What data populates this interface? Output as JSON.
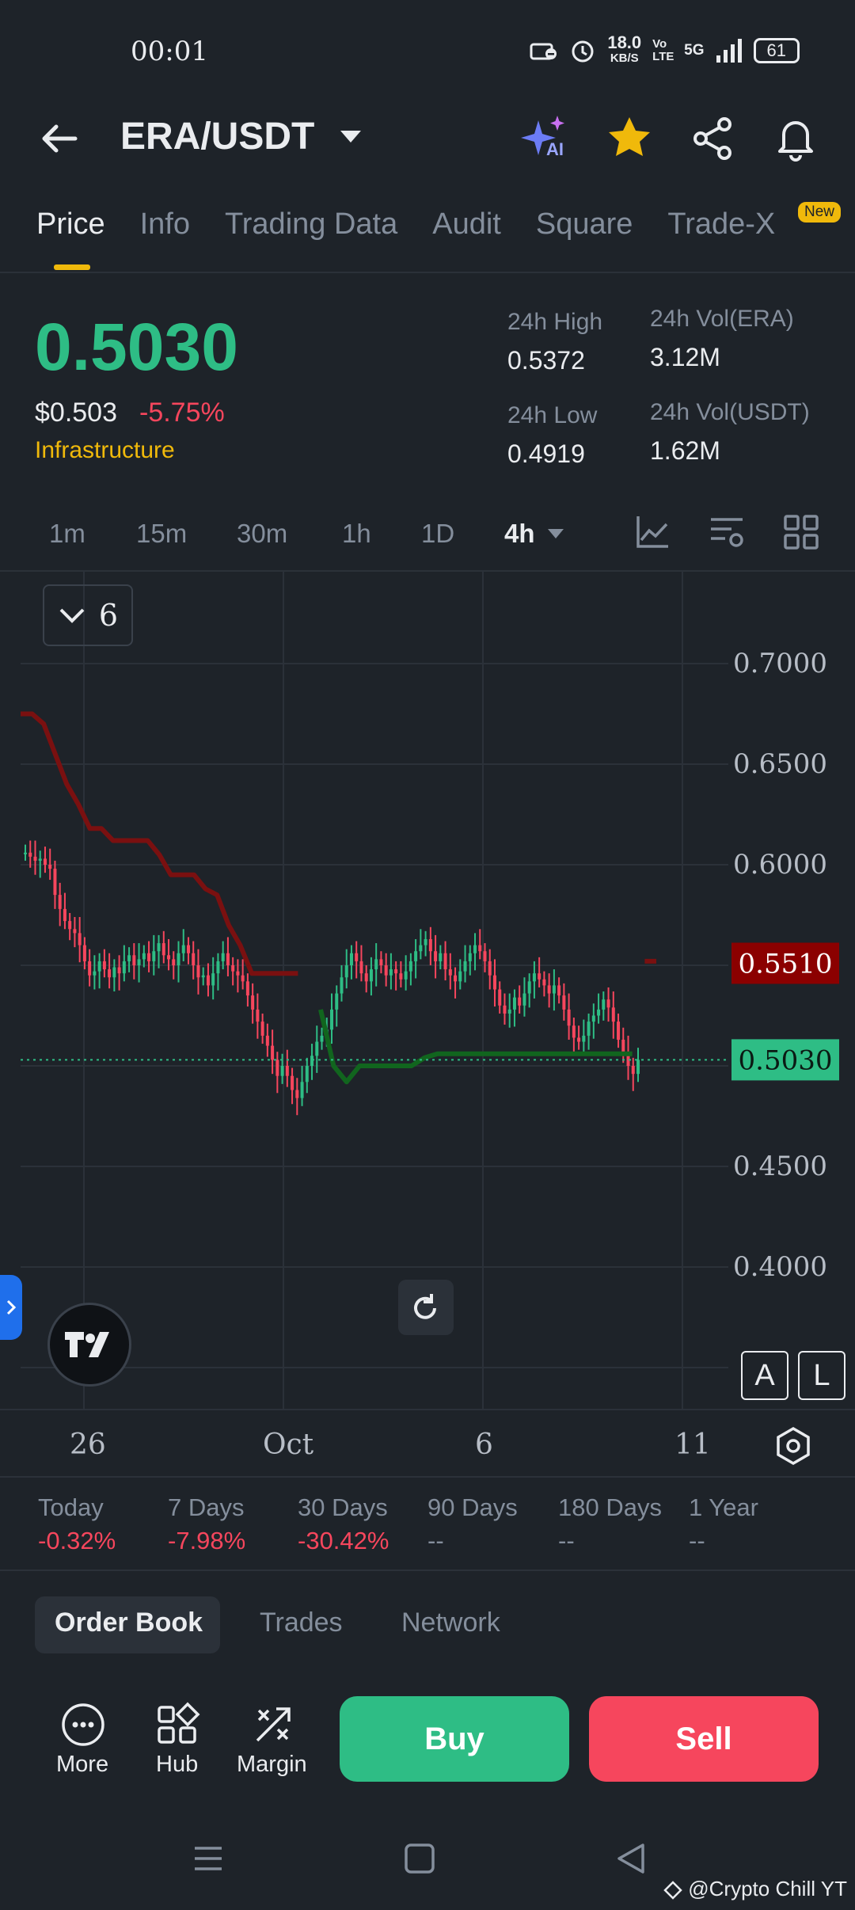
{
  "status": {
    "time": "00:01",
    "net_speed": "18.0",
    "net_unit": "KB/S",
    "volte": "Vo LTE",
    "net_type": "5G",
    "battery": "61"
  },
  "header": {
    "pair": "ERA/USDT",
    "ai_label": "AI"
  },
  "tabs": [
    {
      "label": "Price",
      "active": true
    },
    {
      "label": "Info"
    },
    {
      "label": "Trading Data"
    },
    {
      "label": "Audit"
    },
    {
      "label": "Square"
    },
    {
      "label": "Trade-X"
    }
  ],
  "new_badge": "New",
  "price": {
    "last": "0.5030",
    "fiat": "$0.503",
    "change": "-5.75%",
    "category": "Infrastructure",
    "high_label": "24h High",
    "high": "0.5372",
    "low_label": "24h Low",
    "low": "0.4919",
    "vol_base_label": "24h Vol(ERA)",
    "vol_base": "3.12M",
    "vol_quote_label": "24h Vol(USDT)",
    "vol_quote": "1.62M"
  },
  "timeframes": [
    "1m",
    "15m",
    "30m",
    "1h",
    "1D",
    "4h"
  ],
  "active_timeframe": "4h",
  "indicator_count": "6",
  "chart_data": {
    "type": "candlestick",
    "y_ticks": [
      "0.7000",
      "0.6500",
      "0.6000",
      "0.4500",
      "0.4000"
    ],
    "x_ticks": [
      "26",
      "Oct",
      "6",
      "11"
    ],
    "last_price_label": "0.5030",
    "line_label": "0.5510",
    "ylim": [
      0.38,
      0.72
    ],
    "colors": {
      "up": "#2ebd85",
      "down": "#f6465d",
      "upper_line": "#7a1010",
      "lower_line": "#11651e",
      "last_tag": "#2ebd85",
      "line_tag": "#8b0000"
    },
    "close": [
      0.606,
      0.604,
      0.602,
      0.603,
      0.6,
      0.598,
      0.585,
      0.578,
      0.572,
      0.568,
      0.566,
      0.56,
      0.552,
      0.545,
      0.547,
      0.552,
      0.548,
      0.544,
      0.549,
      0.546,
      0.552,
      0.555,
      0.55,
      0.553,
      0.556,
      0.552,
      0.557,
      0.561,
      0.555,
      0.553,
      0.55,
      0.556,
      0.56,
      0.556,
      0.55,
      0.544,
      0.545,
      0.54,
      0.546,
      0.552,
      0.556,
      0.55,
      0.547,
      0.545,
      0.542,
      0.535,
      0.528,
      0.522,
      0.515,
      0.51,
      0.503,
      0.495,
      0.5,
      0.495,
      0.488,
      0.484,
      0.492,
      0.5,
      0.505,
      0.512,
      0.515,
      0.518,
      0.528,
      0.536,
      0.544,
      0.55,
      0.556,
      0.552,
      0.546,
      0.542,
      0.548,
      0.553,
      0.55,
      0.545,
      0.548,
      0.546,
      0.543,
      0.547,
      0.552,
      0.557,
      0.56,
      0.563,
      0.557,
      0.552,
      0.556,
      0.548,
      0.545,
      0.542,
      0.547,
      0.552,
      0.556,
      0.56,
      0.557,
      0.552,
      0.545,
      0.538,
      0.53,
      0.526,
      0.528,
      0.534,
      0.53,
      0.536,
      0.542,
      0.546,
      0.543,
      0.54,
      0.536,
      0.54,
      0.535,
      0.528,
      0.52,
      0.514,
      0.512,
      0.515,
      0.522,
      0.525,
      0.528,
      0.533,
      0.529,
      0.522,
      0.513,
      0.507,
      0.5,
      0.496,
      0.503
    ],
    "upper_line": [
      0.675,
      0.675,
      0.67,
      0.655,
      0.64,
      0.63,
      0.618,
      0.618,
      0.612,
      0.612,
      0.612,
      0.612,
      0.605,
      0.595,
      0.595,
      0.595,
      0.588,
      0.585,
      0.57,
      0.56,
      0.546,
      0.546,
      0.546,
      0.546,
      0.546,
      null,
      null,
      null,
      null,
      null,
      null,
      null,
      null,
      null,
      null,
      null,
      null,
      null,
      null,
      null,
      null,
      null,
      null,
      null,
      null,
      null,
      null,
      null,
      null,
      null,
      null,
      null,
      null,
      null,
      0.552,
      0.552
    ],
    "lower_line": [
      0.528,
      0.5,
      0.492,
      0.5,
      0.5,
      0.5,
      0.5,
      0.5,
      0.504,
      0.506,
      0.506,
      0.506,
      0.506,
      0.506,
      0.506,
      0.506,
      0.506,
      0.506,
      0.506,
      0.506,
      0.506,
      0.506,
      0.506,
      0.506,
      0.506
    ]
  },
  "perf": [
    {
      "label": "Today",
      "value": "-0.32%"
    },
    {
      "label": "7 Days",
      "value": "-7.98%"
    },
    {
      "label": "30 Days",
      "value": "-30.42%"
    },
    {
      "label": "90 Days",
      "value": "--"
    },
    {
      "label": "180 Days",
      "value": "--"
    },
    {
      "label": "1 Year",
      "value": "--"
    }
  ],
  "bottom_tabs": [
    {
      "label": "Order Book",
      "active": true
    },
    {
      "label": "Trades"
    },
    {
      "label": "Network"
    }
  ],
  "actions": {
    "more": "More",
    "hub": "Hub",
    "margin": "Margin",
    "buy": "Buy",
    "sell": "Sell"
  },
  "chart_buttons": {
    "a": "A",
    "l": "L"
  },
  "watermark": "@Crypto Chill YT"
}
